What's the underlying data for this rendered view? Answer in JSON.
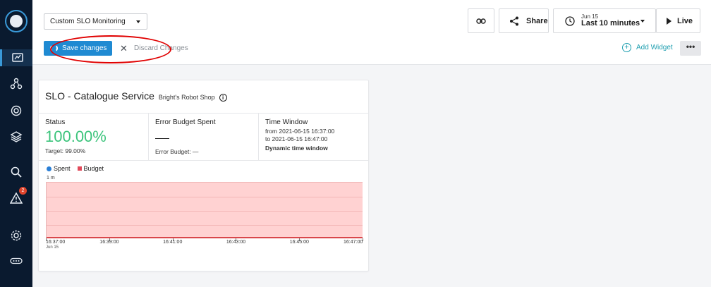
{
  "sidebar": {
    "icons": [
      "app-logo",
      "dashboards-icon",
      "infrastructure-icon",
      "services-icon",
      "applications-icon",
      "analytics-icon",
      "events-icon",
      "settings-icon",
      "more-icon"
    ],
    "events_badge": "2"
  },
  "toolbar": {
    "dashboard_select": "Custom SLO Monitoring",
    "save_label": "Save changes",
    "discard_label": "Discard Changes",
    "share_label": "Share",
    "time_date": "Jun 15",
    "time_range": "Last 10 minutes",
    "live_label": "Live",
    "add_widget_label": "Add Widget",
    "more_label": "•••"
  },
  "widget": {
    "title": "SLO - Catalogue Service",
    "subtitle": "Bright's Robot Shop",
    "status_label": "Status",
    "status_value": "100.00%",
    "target": "Target: 99.00%",
    "error_label": "Error Budget Spent",
    "error_budget": "Error Budget: —",
    "time_window_label": "Time Window",
    "from": "from 2021-06-15 16:37:00",
    "to": "to 2021-06-15 16:47:00",
    "window_type": "Dynamic time window"
  },
  "chart_data": {
    "type": "area",
    "series": [
      {
        "name": "Spent",
        "color": "#2a7fd6",
        "values": [
          0,
          0,
          0,
          0,
          0,
          0
        ]
      },
      {
        "name": "Budget",
        "color": "#e24a5a",
        "values": [
          1,
          1,
          1,
          1,
          1,
          1
        ]
      }
    ],
    "x": [
      "16:37:00",
      "16:39:00",
      "16:41:00",
      "16:43:00",
      "16:45:00",
      "16:47:00"
    ],
    "x_date": "Jun 15",
    "ylabel": "1 m",
    "ylim": [
      0,
      1
    ],
    "legend": "top-left"
  },
  "colors": {
    "accent": "#1f8ad2",
    "status_green": "#3cc47c",
    "budget_fill": "#ffd2d2",
    "sidebar": "#0a1a2f"
  }
}
